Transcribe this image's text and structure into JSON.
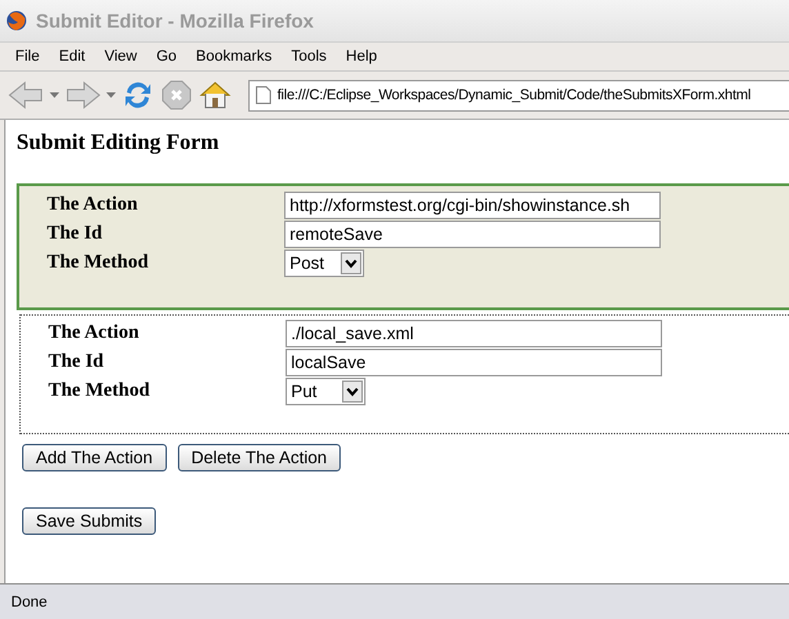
{
  "window": {
    "title": "Submit Editor - Mozilla Firefox"
  },
  "menu": [
    {
      "label": "File"
    },
    {
      "label": "Edit"
    },
    {
      "label": "View"
    },
    {
      "label": "Go"
    },
    {
      "label": "Bookmarks"
    },
    {
      "label": "Tools"
    },
    {
      "label": "Help"
    }
  ],
  "address": {
    "value": "file:///C:/Eclipse_Workspaces/Dynamic_Submit/Code/theSubmitsXForm.xhtml"
  },
  "page": {
    "heading": "Submit Editing Form",
    "submissions": [
      {
        "selected": true,
        "fields": [
          {
            "kind": "text",
            "label": "The Action",
            "value": "http://xformstest.org/cgi-bin/showinstance.sh"
          },
          {
            "kind": "text",
            "label": "The Id",
            "value": "remoteSave"
          },
          {
            "kind": "select",
            "label": "The Method",
            "value": "Post"
          }
        ]
      },
      {
        "selected": false,
        "fields": [
          {
            "kind": "text",
            "label": "The Action",
            "value": "./local_save.xml"
          },
          {
            "kind": "text",
            "label": "The Id",
            "value": "localSave"
          },
          {
            "kind": "select",
            "label": "The Method",
            "value": "Put"
          }
        ]
      }
    ],
    "action_buttons": [
      "Add The Action",
      "Delete The Action"
    ],
    "save_button": "Save Submits"
  },
  "status_bar": {
    "text": "Done"
  }
}
